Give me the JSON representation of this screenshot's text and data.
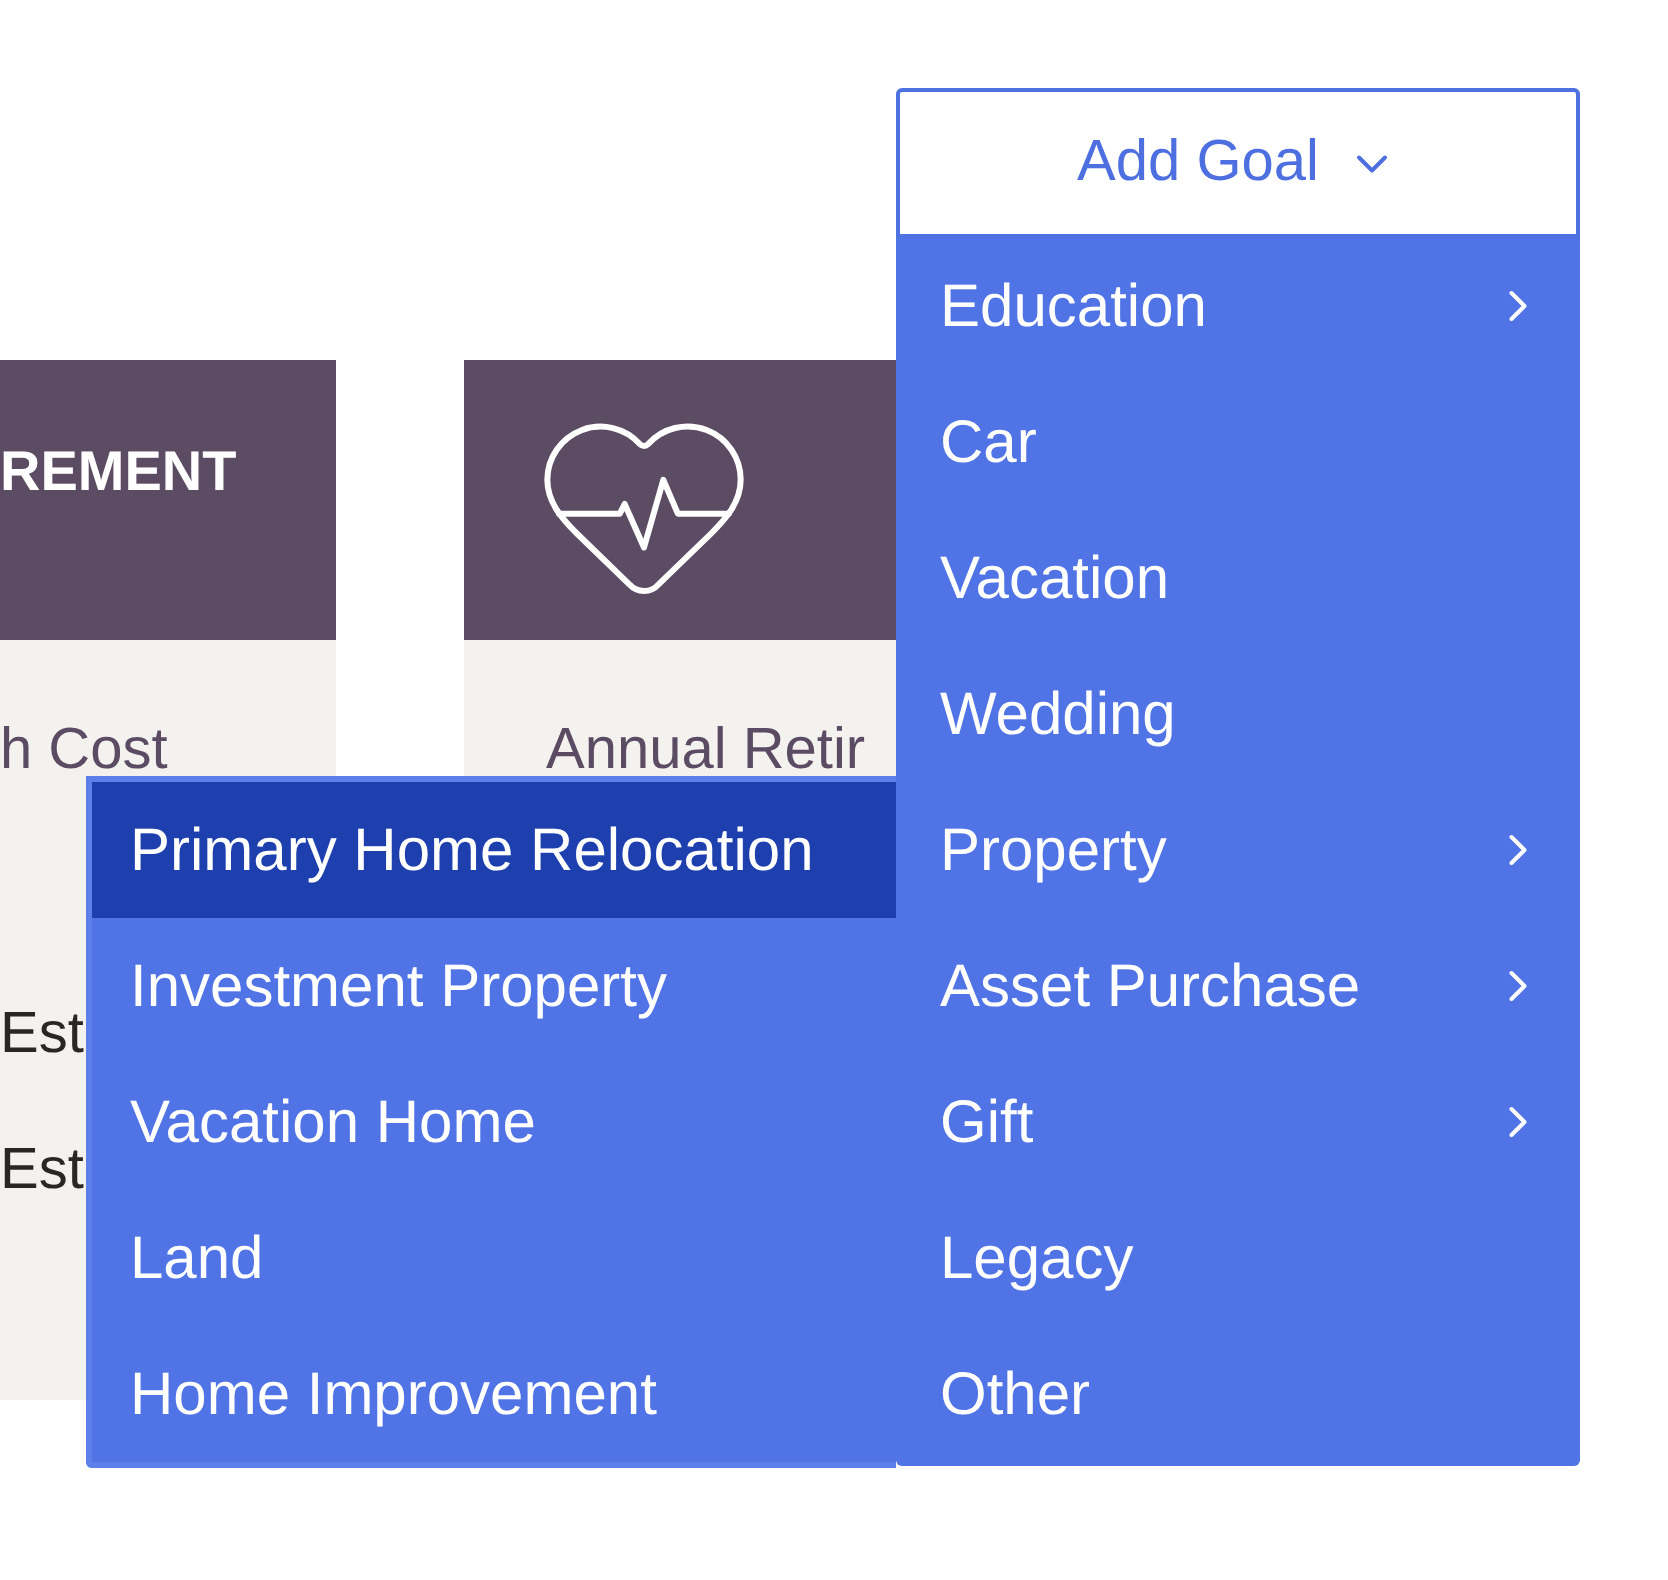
{
  "cards": [
    {
      "kind": "title",
      "title": "REMENT",
      "lines": [
        {
          "kind": "label",
          "text": "h Cost"
        },
        {
          "kind": "value",
          "text": "Est"
        },
        {
          "kind": "value",
          "text": "Est"
        }
      ]
    },
    {
      "kind": "icon",
      "lines": [
        {
          "kind": "label",
          "text": "Annual Retir"
        }
      ]
    }
  ],
  "add_goal": {
    "label": "Add Goal",
    "open": true,
    "items": [
      {
        "label": "Education",
        "has_submenu": true
      },
      {
        "label": "Car",
        "has_submenu": false
      },
      {
        "label": "Vacation",
        "has_submenu": false
      },
      {
        "label": "Wedding",
        "has_submenu": false
      },
      {
        "label": "Property",
        "has_submenu": true,
        "submenu": {
          "items": [
            {
              "label": "Primary Home Relocation",
              "selected": true
            },
            {
              "label": "Investment Property",
              "selected": false
            },
            {
              "label": "Vacation Home",
              "selected": false
            },
            {
              "label": "Land",
              "selected": false
            },
            {
              "label": "Home Improvement",
              "selected": false
            }
          ]
        }
      },
      {
        "label": "Asset Purchase",
        "has_submenu": true
      },
      {
        "label": "Gift",
        "has_submenu": true
      },
      {
        "label": "Legacy",
        "has_submenu": false
      },
      {
        "label": "Other",
        "has_submenu": false
      }
    ]
  }
}
